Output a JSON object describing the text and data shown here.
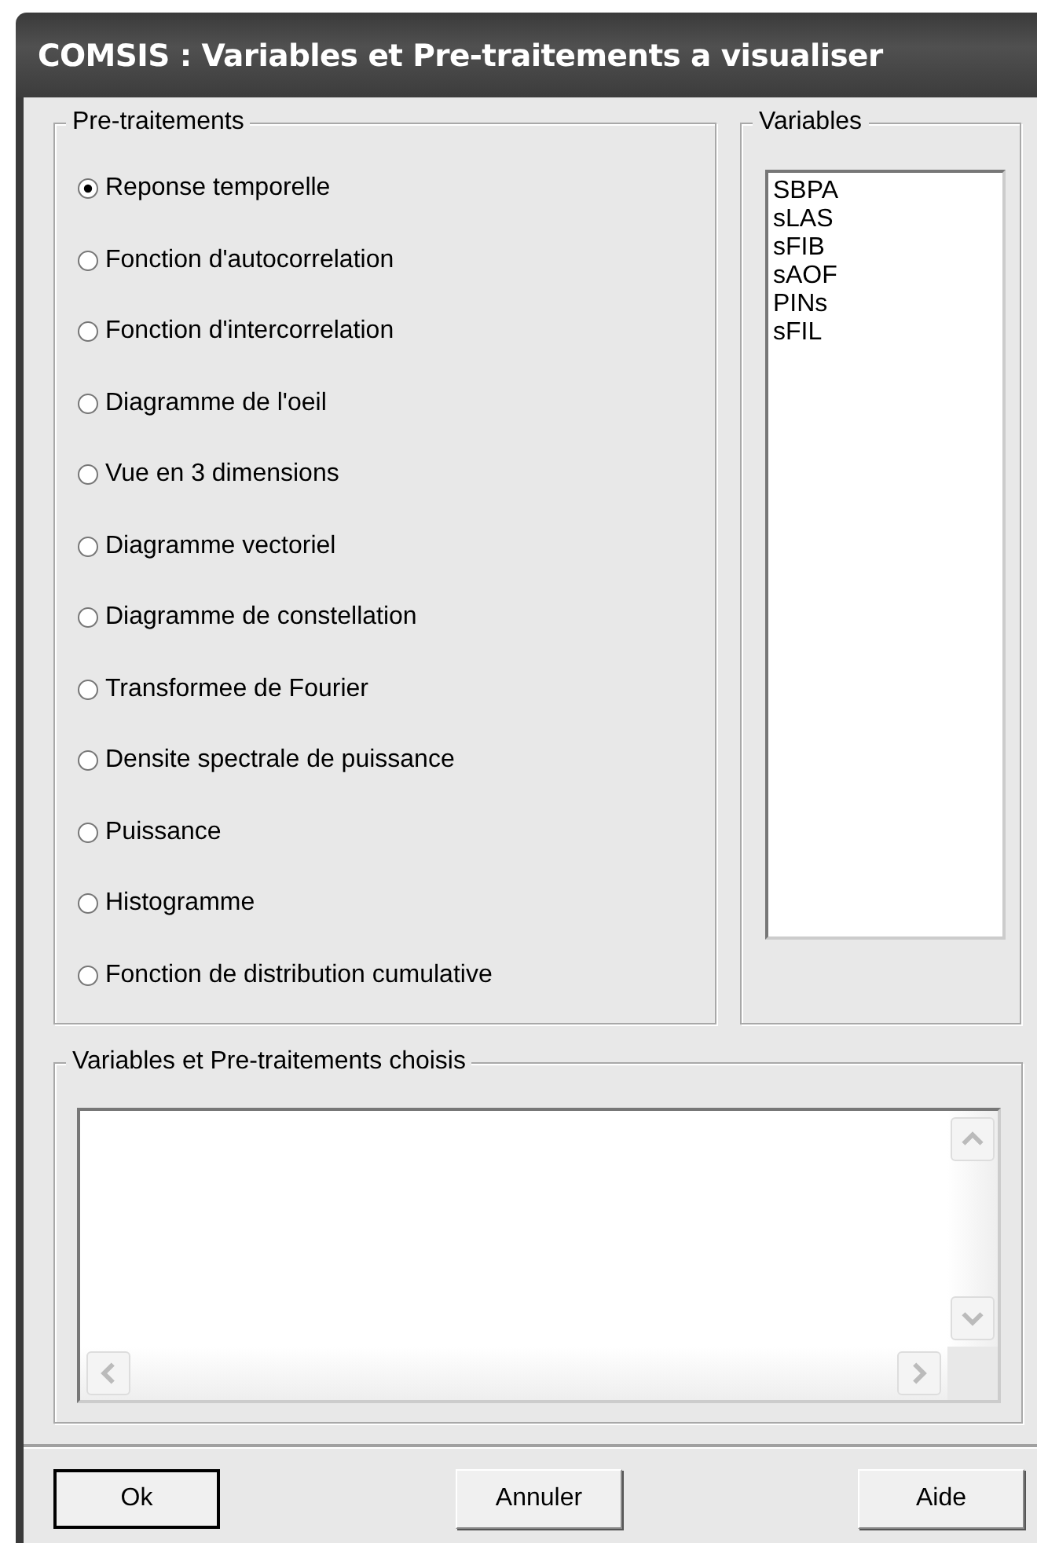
{
  "window": {
    "title": "COMSIS : Variables et Pre-traitements a visualiser"
  },
  "pretraitements": {
    "title": "Pre-traitements",
    "options": [
      {
        "label": "Reponse temporelle",
        "selected": true
      },
      {
        "label": "Fonction d'autocorrelation",
        "selected": false
      },
      {
        "label": "Fonction d'intercorrelation",
        "selected": false
      },
      {
        "label": "Diagramme de l'oeil",
        "selected": false
      },
      {
        "label": "Vue en 3 dimensions",
        "selected": false
      },
      {
        "label": "Diagramme vectoriel",
        "selected": false
      },
      {
        "label": "Diagramme de constellation",
        "selected": false
      },
      {
        "label": "Transformee de Fourier",
        "selected": false
      },
      {
        "label": "Densite spectrale de puissance",
        "selected": false
      },
      {
        "label": "Puissance",
        "selected": false
      },
      {
        "label": "Histogramme",
        "selected": false
      },
      {
        "label": "Fonction de distribution cumulative",
        "selected": false
      }
    ]
  },
  "variables": {
    "title": "Variables",
    "items": [
      "SBPA",
      "sLAS",
      "sFIB",
      "sAOF",
      "PINs",
      "sFIL"
    ]
  },
  "chosen": {
    "title": "Variables et Pre-traitements choisis"
  },
  "buttons": [
    {
      "label": "Ok",
      "default": true
    },
    {
      "label": "Annuler",
      "default": false
    },
    {
      "label": "Aide",
      "default": false
    }
  ]
}
